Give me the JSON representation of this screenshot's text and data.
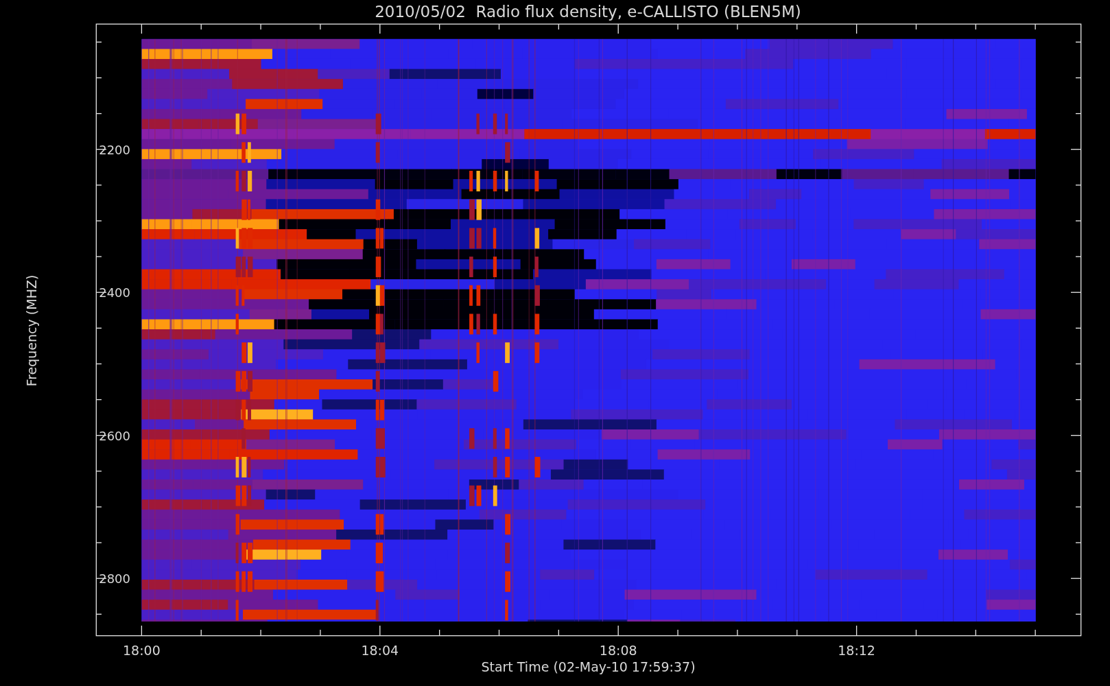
{
  "title": "2010/05/02  Radio flux density, e-CALLISTO (BLEN5M)",
  "y_axis": {
    "label": "Frequency (MHZ)",
    "ticks": [
      "2200",
      "2400",
      "2600",
      "2800"
    ]
  },
  "x_axis": {
    "label": "Start Time (02-May-10 17:59:37)",
    "ticks": [
      "18:00",
      "18:04",
      "18:08",
      "18:12"
    ]
  }
}
